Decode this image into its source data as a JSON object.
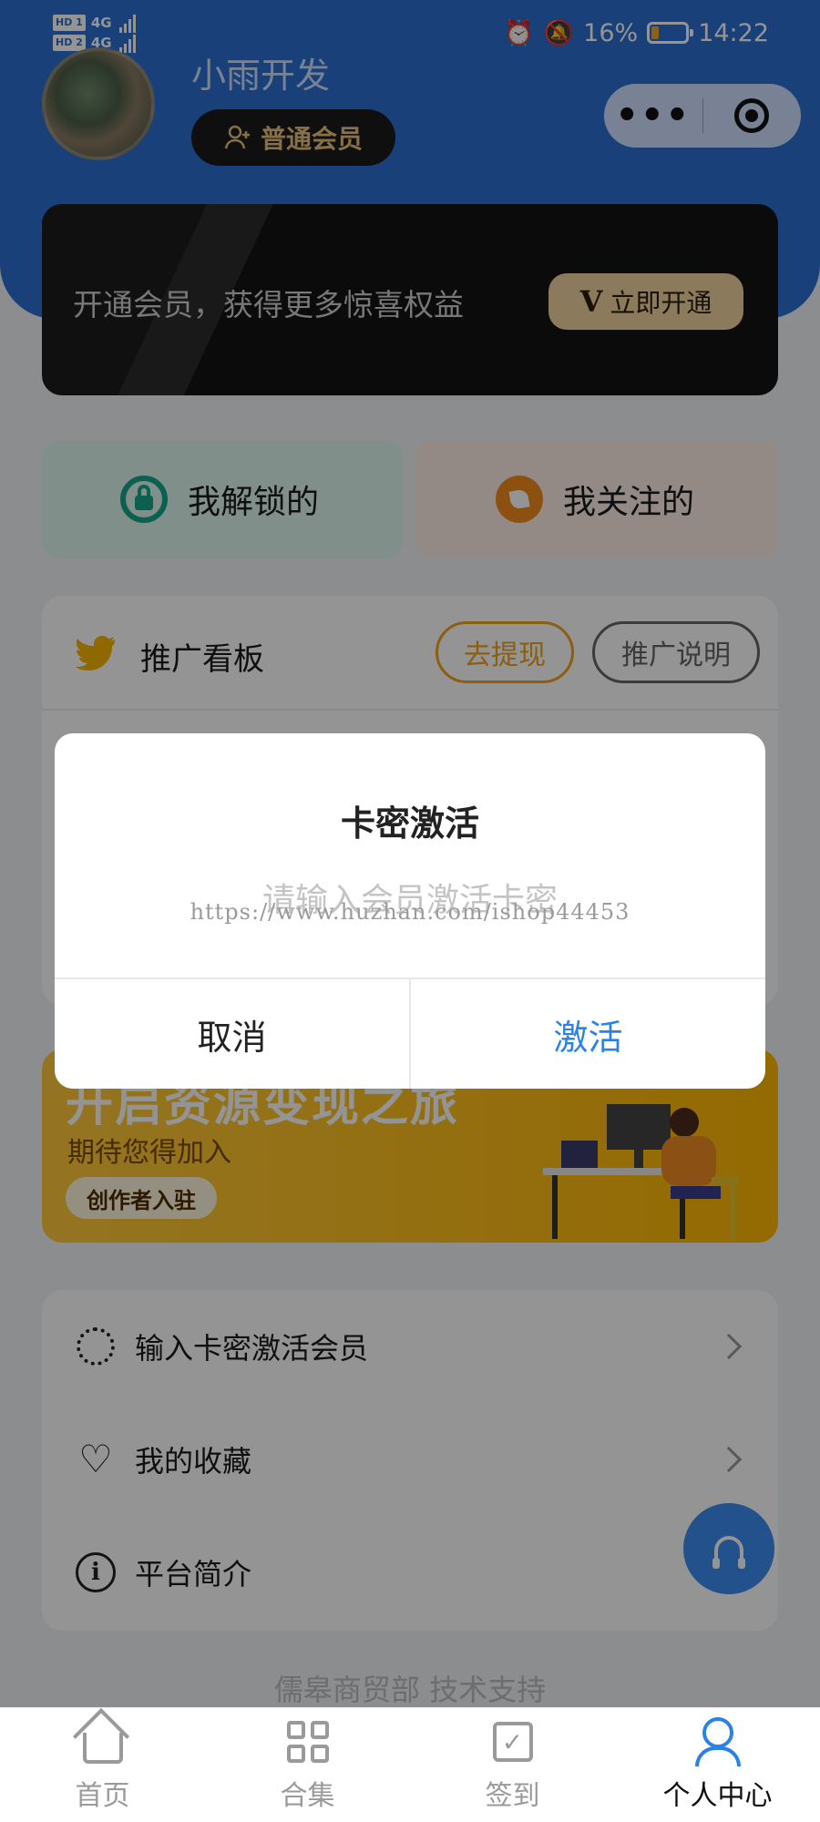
{
  "status_bar": {
    "hd1": "HD 1",
    "hd2": "HD 2",
    "net1": "4G",
    "net2": "4G",
    "battery": "16%",
    "time": "14:22"
  },
  "header": {
    "user_name": "小雨开发",
    "member_level": "普通会员"
  },
  "vip_banner": {
    "text": "开通会员，获得更多惊喜权益",
    "button_icon": "V",
    "button": "立即开通"
  },
  "quick_links": {
    "unlocked": "我解锁的",
    "following": "我关注的"
  },
  "promo_board": {
    "title": "推广看板",
    "withdraw": "去提现",
    "explain": "推广说明"
  },
  "creator_banner": {
    "title": "开启资源变现之旅",
    "subtitle": "期待您得加入",
    "button": "创作者入驻"
  },
  "menu": {
    "items": [
      {
        "label": "输入卡密激活会员",
        "icon": "badge-icon"
      },
      {
        "label": "我的收藏",
        "icon": "heart-icon"
      },
      {
        "label": "平台简介",
        "icon": "info-icon"
      }
    ]
  },
  "footer": {
    "support": "儒皋商贸部 技术支持"
  },
  "tabbar": {
    "items": [
      {
        "label": "首页",
        "icon": "home-icon"
      },
      {
        "label": "合集",
        "icon": "grid-icon"
      },
      {
        "label": "签到",
        "icon": "checkbox-icon"
      },
      {
        "label": "个人中心",
        "icon": "person-icon"
      }
    ],
    "active_color": "#2b82e6"
  },
  "modal": {
    "title": "卡密激活",
    "placeholder": "请输入会员激活卡密",
    "watermark": "https://www.huzhan.com/ishop44453",
    "cancel": "取消",
    "confirm": "激活"
  },
  "colors": {
    "header_blue": "#2c6fd1",
    "accent_blue": "#2b82e6",
    "orange": "#f2a21a",
    "teal": "#13a58b"
  }
}
